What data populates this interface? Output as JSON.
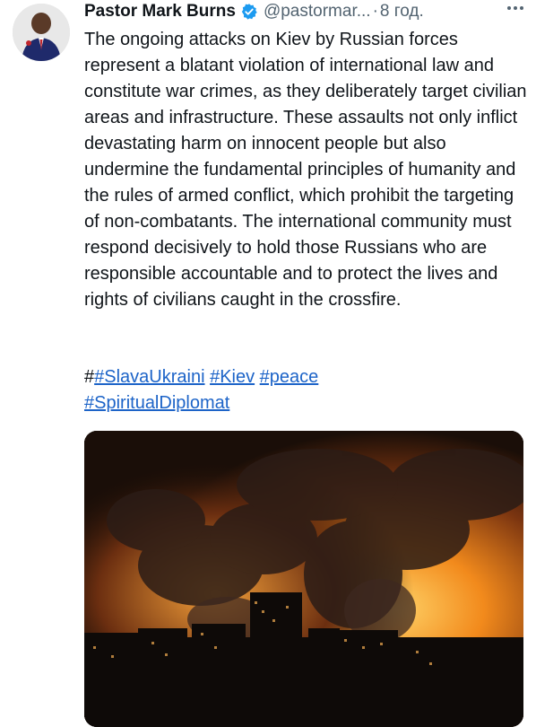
{
  "tweet": {
    "author_name": "Pastor Mark Burns",
    "handle": "@pastormar...",
    "separator": "·",
    "time": "8 год.",
    "body": "The ongoing attacks on Kiev by Russian forces represent a blatant violation of international law and constitute war crimes, as they deliberately target civilian areas and infrastructure. These assaults not only inflict devastating harm on innocent people but also undermine the fundamental principles of humanity and the rules of armed conflict, which prohibit the targeting of non-combatants. The international community must respond decisively to hold those Russians who are responsible accountable and to protect the lives and rights of civilians caught in the crossfire.",
    "hashtag_prefix": "#",
    "hashtags": [
      "#SlavaUkraini",
      "#Kiev",
      "#peace",
      "#SpiritualDiplomat"
    ]
  },
  "colors": {
    "link": "#1d64c8",
    "verified_badge": "#1d9bf0",
    "secondary_text": "#536471"
  },
  "icons": {
    "verified": "verified-badge-icon",
    "more": "more-horizontal-icon"
  }
}
